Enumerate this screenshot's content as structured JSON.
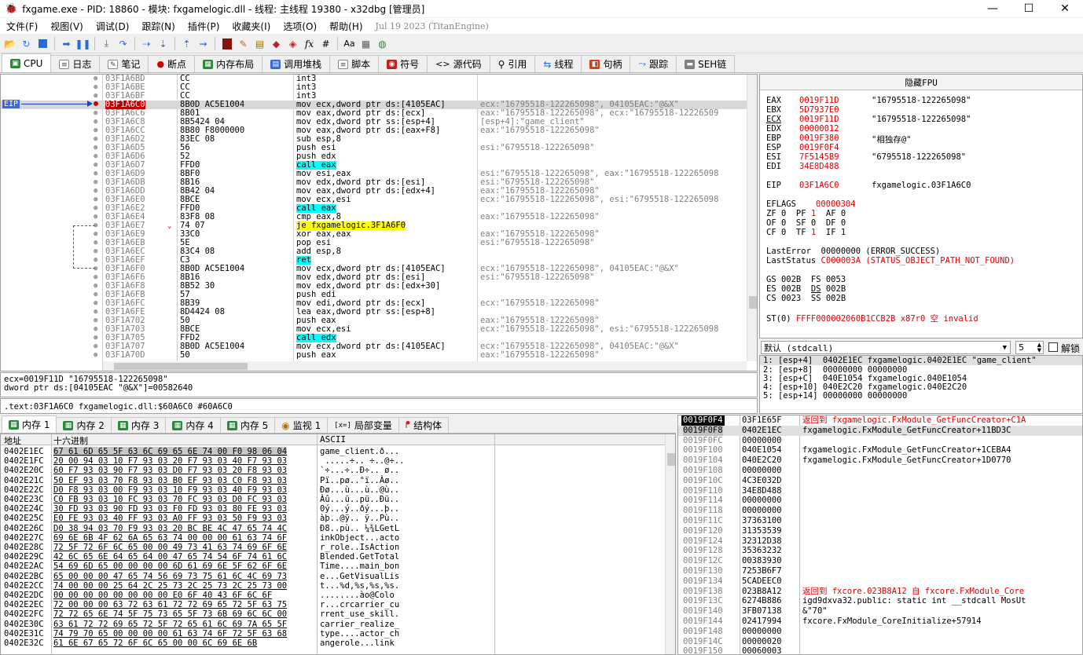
{
  "title": "fxgame.exe - PID: 18860 - 模块: fxgamelogic.dll - 线程: 主线程 19380 - x32dbg [管理员]",
  "window_controls": {
    "minimize": "—",
    "maximize": "☐",
    "close": "✕"
  },
  "menu": [
    "文件(F)",
    "视图(V)",
    "调试(D)",
    "跟踪(N)",
    "插件(P)",
    "收藏夹(I)",
    "选项(O)",
    "帮助(H)"
  ],
  "menu_date": "Jul 19 2023 (TitanEngine)",
  "tabs": [
    "CPU",
    "日志",
    "笔记",
    "断点",
    "内存布局",
    "调用堆栈",
    "脚本",
    "符号",
    "源代码",
    "引用",
    "线程",
    "句柄",
    "跟踪",
    "SEH链"
  ],
  "eip_label": "EIP",
  "disasm": [
    {
      "addr": "03F1A6BD",
      "bytes": "CC",
      "instr": "int3",
      "cmt": ""
    },
    {
      "addr": "03F1A6BE",
      "bytes": "CC",
      "instr": "int3",
      "cmt": ""
    },
    {
      "addr": "03F1A6BF",
      "bytes": "CC",
      "instr": "int3",
      "cmt": ""
    },
    {
      "addr": "03F1A6C0",
      "bytes": "8B0D AC5E1004",
      "instr": "mov ecx,dword ptr ds:[4105EAC]",
      "cmt": "ecx:\"16795518-122265098\", 04105EAC:\"@&X\""
    },
    {
      "addr": "03F1A6C6",
      "bytes": "8B01",
      "instr": "mov eax,dword ptr ds:[ecx]",
      "cmt": "eax:\"16795518-122265098\", ecx:\"16795518-12226509"
    },
    {
      "addr": "03F1A6C8",
      "bytes": "8B5424 04",
      "instr": "mov edx,dword ptr ss:[esp+4]",
      "cmt": "[esp+4]:\"game_client\""
    },
    {
      "addr": "03F1A6CC",
      "bytes": "8B80 F8000000",
      "instr": "mov eax,dword ptr ds:[eax+F8]",
      "cmt": "eax:\"16795518-122265098\""
    },
    {
      "addr": "03F1A6D2",
      "bytes": "83EC 08",
      "instr": "sub esp,8",
      "cmt": ""
    },
    {
      "addr": "03F1A6D5",
      "bytes": "56",
      "instr": "push esi",
      "cmt": "esi:\"6795518-122265098\""
    },
    {
      "addr": "03F1A6D6",
      "bytes": "52",
      "instr": "push edx",
      "cmt": ""
    },
    {
      "addr": "03F1A6D7",
      "bytes": "FFD0",
      "instr": "call eax",
      "cmt": ""
    },
    {
      "addr": "03F1A6D9",
      "bytes": "8BF0",
      "instr": "mov esi,eax",
      "cmt": "esi:\"6795518-122265098\", eax:\"16795518-122265098"
    },
    {
      "addr": "03F1A6DB",
      "bytes": "8B16",
      "instr": "mov edx,dword ptr ds:[esi]",
      "cmt": "esi:\"6795518-122265098\""
    },
    {
      "addr": "03F1A6DD",
      "bytes": "8B42 04",
      "instr": "mov eax,dword ptr ds:[edx+4]",
      "cmt": "eax:\"16795518-122265098\""
    },
    {
      "addr": "03F1A6E0",
      "bytes": "8BCE",
      "instr": "mov ecx,esi",
      "cmt": "ecx:\"16795518-122265098\", esi:\"6795518-122265098"
    },
    {
      "addr": "03F1A6E2",
      "bytes": "FFD0",
      "instr": "call eax",
      "cmt": ""
    },
    {
      "addr": "03F1A6E4",
      "bytes": "83F8 08",
      "instr": "cmp eax,8",
      "cmt": "eax:\"16795518-122265098\""
    },
    {
      "addr": "03F1A6E7",
      "bytes": "74 07",
      "instr": "je fxgamelogic.3F1A6F0",
      "cmt": ""
    },
    {
      "addr": "03F1A6E9",
      "bytes": "33C0",
      "instr": "xor eax,eax",
      "cmt": "eax:\"16795518-122265098\""
    },
    {
      "addr": "03F1A6EB",
      "bytes": "5E",
      "instr": "pop esi",
      "cmt": "esi:\"6795518-122265098\""
    },
    {
      "addr": "03F1A6EC",
      "bytes": "83C4 08",
      "instr": "add esp,8",
      "cmt": ""
    },
    {
      "addr": "03F1A6EF",
      "bytes": "C3",
      "instr": "ret",
      "cmt": ""
    },
    {
      "addr": "03F1A6F0",
      "bytes": "8B0D AC5E1004",
      "instr": "mov ecx,dword ptr ds:[4105EAC]",
      "cmt": "ecx:\"16795518-122265098\", 04105EAC:\"@&X\""
    },
    {
      "addr": "03F1A6F6",
      "bytes": "8B16",
      "instr": "mov edx,dword ptr ds:[esi]",
      "cmt": "esi:\"6795518-122265098\""
    },
    {
      "addr": "03F1A6F8",
      "bytes": "8B52 30",
      "instr": "mov edx,dword ptr ds:[edx+30]",
      "cmt": ""
    },
    {
      "addr": "03F1A6FB",
      "bytes": "57",
      "instr": "push edi",
      "cmt": ""
    },
    {
      "addr": "03F1A6FC",
      "bytes": "8B39",
      "instr": "mov edi,dword ptr ds:[ecx]",
      "cmt": "ecx:\"16795518-122265098\""
    },
    {
      "addr": "03F1A6FE",
      "bytes": "8D4424 08",
      "instr": "lea eax,dword ptr ss:[esp+8]",
      "cmt": ""
    },
    {
      "addr": "03F1A702",
      "bytes": "50",
      "instr": "push eax",
      "cmt": "eax:\"16795518-122265098\""
    },
    {
      "addr": "03F1A703",
      "bytes": "8BCE",
      "instr": "mov ecx,esi",
      "cmt": "ecx:\"16795518-122265098\", esi:\"6795518-122265098"
    },
    {
      "addr": "03F1A705",
      "bytes": "FFD2",
      "instr": "call edx",
      "cmt": ""
    },
    {
      "addr": "03F1A707",
      "bytes": "8B0D AC5E1004",
      "instr": "mov ecx,dword ptr ds:[4105EAC]",
      "cmt": "ecx:\"16795518-122265098\", 04105EAC:\"@&X\""
    },
    {
      "addr": "03F1A70D",
      "bytes": "50",
      "instr": "push eax",
      "cmt": "eax:\"16795518-122265098\""
    }
  ],
  "info": {
    "line1": "ecx=0019F11D \"16795518-122265098\"",
    "line2": "dword ptr ds:[04105EAC \"@&X\"]=00582640",
    "status": ".text:03F1A6C0 fxgamelogic.dll:$60A6C0 #60A6C0"
  },
  "regs": {
    "header": "隐藏FPU",
    "general": [
      {
        "n": "EAX",
        "v": "0019F11D",
        "c": "\"16795518-122265098\""
      },
      {
        "n": "EBX",
        "v": "5D7937E0",
        "c": ""
      },
      {
        "n": "ECX",
        "v": "0019F11D",
        "c": "\"16795518-122265098\""
      },
      {
        "n": "EDX",
        "v": "00000012",
        "c": ""
      },
      {
        "n": "EBP",
        "v": "0019F380",
        "c": "\"相独存@\""
      },
      {
        "n": "ESP",
        "v": "0019F0F4",
        "c": ""
      },
      {
        "n": "ESI",
        "v": "7F5145B9",
        "c": "\"6795518-122265098\""
      },
      {
        "n": "EDI",
        "v": "34E8D488",
        "c": ""
      }
    ],
    "eip": {
      "n": "EIP",
      "v": "03F1A6C0",
      "c": "fxgamelogic.03F1A6C0"
    },
    "eflags": {
      "n": "EFLAGS",
      "v": "00000304"
    },
    "flags": [
      "ZF 0  PF 1  AF 0",
      "OF 0  SF 0  DF 0",
      "CF 0  TF 1  IF 1"
    ],
    "lasterror": "LastError  00000000 (ERROR_SUCCESS)",
    "laststatus_label": "LastStatus",
    "laststatus_val": "C000003A (STATUS_OBJECT_PATH_NOT_FOUND)",
    "segs": [
      "GS 002B  FS 0053",
      "ES 002B  DS 002B",
      "CS 0023  SS 002B"
    ],
    "st0_label": "ST(0)",
    "st0_val": "FFFF000002060B1CCB2B x87r0 空",
    "st0_inv": "invalid"
  },
  "stackargs": {
    "conv": "默认 (stdcall)",
    "count": "5",
    "unlock": "解锁",
    "rows": [
      "1: [esp+4]  0402E1EC fxgamelogic.0402E1EC \"game_client\"",
      "2: [esp+8]  00000000 00000000",
      "3: [esp+C]  040E1054 fxgamelogic.040E1054",
      "4: [esp+10] 040E2C20 fxgamelogic.040E2C20",
      "5: [esp+14] 00000000 00000000"
    ]
  },
  "memtabs": [
    "内存 1",
    "内存 2",
    "内存 3",
    "内存 4",
    "内存 5",
    "监视 1",
    "局部变量",
    "结构体"
  ],
  "dump": {
    "h_addr": "地址",
    "h_hex": "十六进制",
    "h_ascii": "ASCII",
    "rows": [
      {
        "a": "0402E1EC",
        "h": "67 61 6D 65 5F 63 6C 69 65 6E 74 00 F0 98 06 04",
        "t": "game_client.ð..."
      },
      {
        "a": "0402E1FC",
        "h": "20 00 94 03 10 F7 93 03 20 F7 93 03 40 F7 93 03",
        "t": " .....÷.. ÷..@÷.."
      },
      {
        "a": "0402E20C",
        "h": "60 F7 93 03 90 F7 93 03 D0 F7 93 03 20 F8 93 03",
        "t": "`÷...÷..Ð÷.. ø.."
      },
      {
        "a": "0402E21C",
        "h": "50 EF 93 03 70 F8 93 03 B0 EF 93 03 C0 F8 93 03",
        "t": "Pï..pø..°ï..Àø.."
      },
      {
        "a": "0402E22C",
        "h": "D0 F8 93 03 00 F9 93 03 10 F9 93 03 40 F9 93 03",
        "t": "Ðø...ù...ù..@ù.."
      },
      {
        "a": "0402E23C",
        "h": "C0 FB 93 03 10 FC 93 03 70 FC 93 03 D0 FC 93 03",
        "t": "Àû...ü..pü..Ðü.."
      },
      {
        "a": "0402E24C",
        "h": "30 FD 93 03 90 FD 93 03 F0 FD 93 03 80 FE 93 03",
        "t": "0ý...ý..ðý...þ.."
      },
      {
        "a": "0402E25C",
        "h": "E0 FE 93 03 40 FF 93 03 A0 FF 93 03 50 F9 93 03",
        "t": "àþ..@ÿ.. ÿ..Pù.."
      },
      {
        "a": "0402E26C",
        "h": "D0 38 94 03 70 F9 93 03 20 BC BE 4C 47 65 74 4C",
        "t": "Ð8..pù.. ¼¾LGetL"
      },
      {
        "a": "0402E27C",
        "h": "69 6E 6B 4F 62 6A 65 63 74 00 00 00 61 63 74 6F",
        "t": "inkObject...acto"
      },
      {
        "a": "0402E28C",
        "h": "72 5F 72 6F 6C 65 00 00 49 73 41 63 74 69 6F 6E",
        "t": "r_role..IsAction"
      },
      {
        "a": "0402E29C",
        "h": "42 6C 65 6E 64 65 64 00 47 65 74 54 6F 74 61 6C",
        "t": "Blended.GetTotal"
      },
      {
        "a": "0402E2AC",
        "h": "54 69 6D 65 00 00 00 00 6D 61 69 6E 5F 62 6F 6E",
        "t": "Time....main_bon"
      },
      {
        "a": "0402E2BC",
        "h": "65 00 00 00 47 65 74 56 69 73 75 61 6C 4C 69 73",
        "t": "e...GetVisualLis"
      },
      {
        "a": "0402E2CC",
        "h": "74 00 00 00 25 64 2C 25 73 2C 25 73 2C 25 73 00",
        "t": "t...%d,%s,%s,%s."
      },
      {
        "a": "0402E2DC",
        "h": "00 00 00 00 00 00 00 00 E0 6F 40 43 6F 6C 6F",
        "t": "........ào@Colo"
      },
      {
        "a": "0402E2EC",
        "h": "72 00 00 00 63 72 63 61 72 72 69 65 72 5F 63 75",
        "t": "r...crcarrier_cu"
      },
      {
        "a": "0402E2FC",
        "h": "72 72 65 6E 74 5F 75 73 65 5F 73 6B 69 6C 6C 00",
        "t": "rrent_use_skill."
      },
      {
        "a": "0402E30C",
        "h": "63 61 72 72 69 65 72 5F 72 65 61 6C 69 7A 65 5F",
        "t": "carrier_realize_"
      },
      {
        "a": "0402E31C",
        "h": "74 79 70 65 00 00 00 00 61 63 74 6F 72 5F 63 68",
        "t": "type....actor_ch"
      },
      {
        "a": "0402E32C",
        "h": "61 6E 67 65 72 6F 6C 65 00 00 6C 69 6E 6B",
        "t": "angerole...link"
      }
    ]
  },
  "stack": [
    {
      "a": "0019F0F4",
      "v": "03F1E65F",
      "c": "返回到 fxgamelogic.FxModule_GetFuncCreator+C1A",
      "red": true,
      "cur": true
    },
    {
      "a": "0019F0F8",
      "v": "0402E1EC",
      "c": "fxgamelogic.FxModule_GetFuncCreator+11BD3C",
      "red": false,
      "sel": true
    },
    {
      "a": "0019F0FC",
      "v": "00000000",
      "c": "",
      "red": false
    },
    {
      "a": "0019F100",
      "v": "040E1054",
      "c": "fxgamelogic.FxModule_GetFuncCreator+1CEBA4",
      "red": false
    },
    {
      "a": "0019F104",
      "v": "040E2C20",
      "c": "fxgamelogic.FxModule_GetFuncCreator+1D0770",
      "red": false
    },
    {
      "a": "0019F108",
      "v": "00000000",
      "c": "",
      "red": false
    },
    {
      "a": "0019F10C",
      "v": "4C3E032D",
      "c": "",
      "red": false
    },
    {
      "a": "0019F110",
      "v": "34E8D488",
      "c": "",
      "red": false
    },
    {
      "a": "0019F114",
      "v": "00000000",
      "c": "",
      "red": false
    },
    {
      "a": "0019F118",
      "v": "00000000",
      "c": "",
      "red": false
    },
    {
      "a": "0019F11C",
      "v": "37363100",
      "c": "",
      "red": false
    },
    {
      "a": "0019F120",
      "v": "31353539",
      "c": "",
      "red": false
    },
    {
      "a": "0019F124",
      "v": "32312D38",
      "c": "",
      "red": false
    },
    {
      "a": "0019F128",
      "v": "35363232",
      "c": "",
      "red": false
    },
    {
      "a": "0019F12C",
      "v": "00383930",
      "c": "",
      "red": false
    },
    {
      "a": "0019F130",
      "v": "7253B6F7",
      "c": "",
      "red": false
    },
    {
      "a": "0019F134",
      "v": "5CADEEC0",
      "c": "",
      "red": false
    },
    {
      "a": "0019F138",
      "v": "023B8A12",
      "c": "返回到 fxcore.023B8A12 自 fxcore.FxModule_Core",
      "red": true
    },
    {
      "a": "0019F13C",
      "v": "6274B886",
      "c": "igd9dxva32.public: static int __stdcall MosUt",
      "red": false
    },
    {
      "a": "0019F140",
      "v": "3FB07138",
      "c": "&\"70\"",
      "red": false
    },
    {
      "a": "0019F144",
      "v": "02417994",
      "c": "fxcore.FxModule_CoreInitialize+57914",
      "red": false
    },
    {
      "a": "0019F148",
      "v": "00000000",
      "c": "",
      "red": false
    },
    {
      "a": "0019F14C",
      "v": "00000020",
      "c": "",
      "red": false
    },
    {
      "a": "0019F150",
      "v": "00060003",
      "c": "",
      "red": false
    }
  ]
}
